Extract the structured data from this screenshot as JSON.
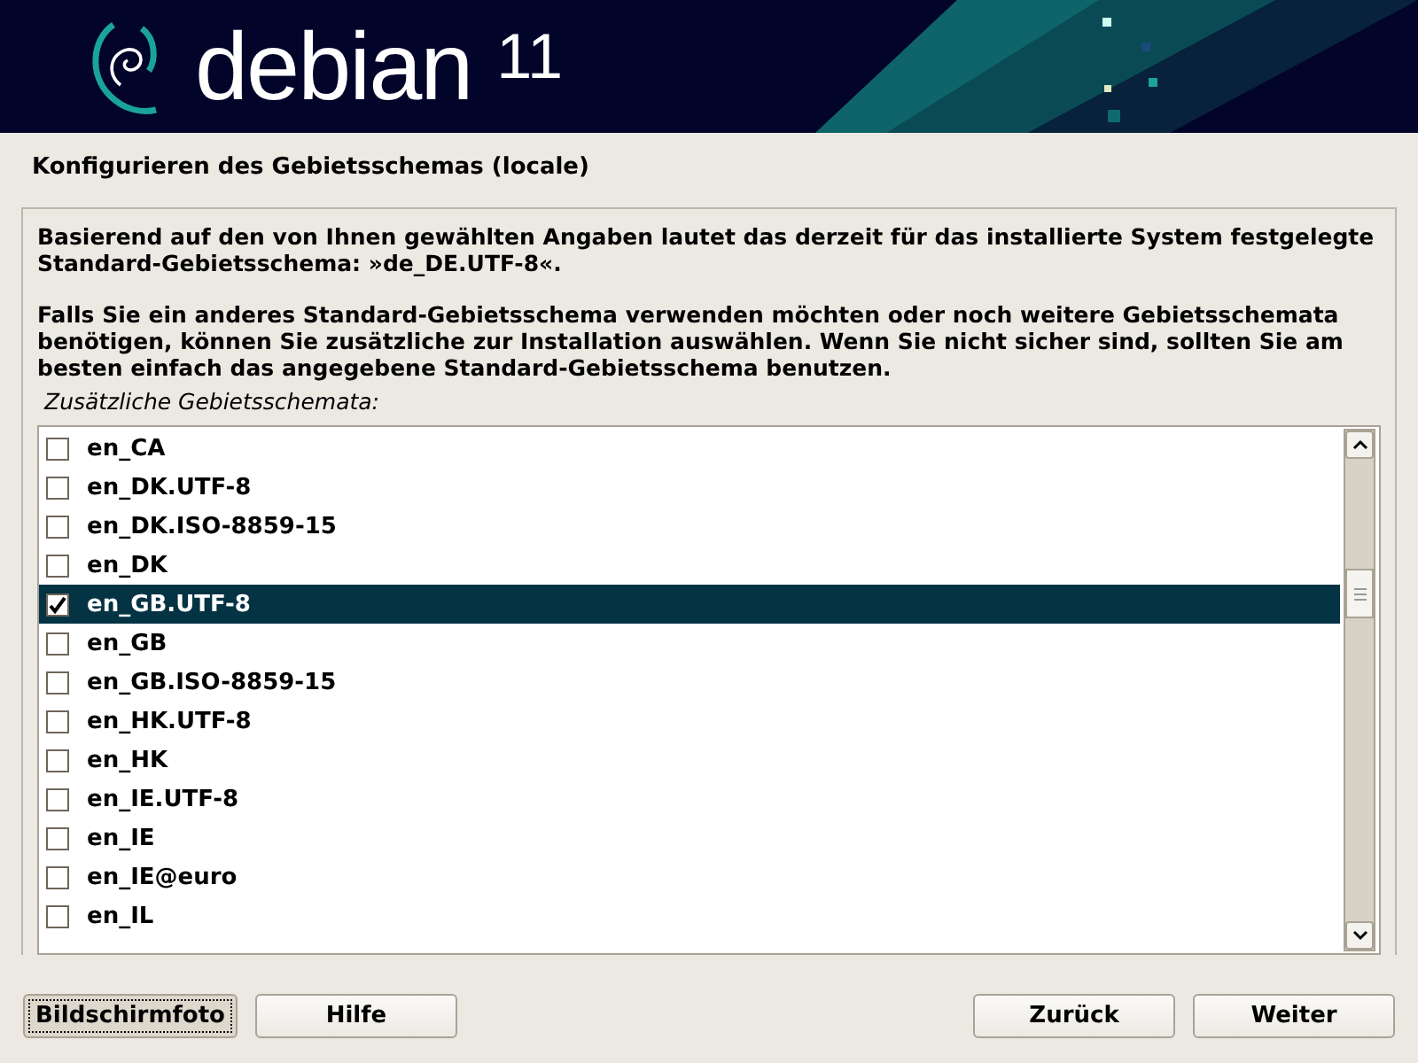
{
  "header": {
    "brand": "debian",
    "version": "11"
  },
  "title": "Konfigurieren des Gebietsschemas (locale)",
  "paragraphs": [
    "Basierend auf den von Ihnen gewählten Angaben lautet das derzeit für das installierte System festgelegte Standard-Gebietsschema: »de_DE.UTF-8«.",
    "Falls Sie ein anderes Standard-Gebietsschema verwenden möchten oder noch weitere Gebietsschemata benötigen, können Sie zusätzliche zur Installation auswählen. Wenn Sie nicht sicher sind, sollten Sie am besten einfach das angegebene Standard-Gebietsschema benutzen."
  ],
  "list_label": "Zusätzliche Gebietsschemata:",
  "locales": [
    {
      "label": "en_CA",
      "checked": false,
      "selected": false
    },
    {
      "label": "en_DK.UTF-8",
      "checked": false,
      "selected": false
    },
    {
      "label": "en_DK.ISO-8859-15",
      "checked": false,
      "selected": false
    },
    {
      "label": "en_DK",
      "checked": false,
      "selected": false
    },
    {
      "label": "en_GB.UTF-8",
      "checked": true,
      "selected": true
    },
    {
      "label": "en_GB",
      "checked": false,
      "selected": false
    },
    {
      "label": "en_GB.ISO-8859-15",
      "checked": false,
      "selected": false
    },
    {
      "label": "en_HK.UTF-8",
      "checked": false,
      "selected": false
    },
    {
      "label": "en_HK",
      "checked": false,
      "selected": false
    },
    {
      "label": "en_IE.UTF-8",
      "checked": false,
      "selected": false
    },
    {
      "label": "en_IE",
      "checked": false,
      "selected": false
    },
    {
      "label": "en_IE@euro",
      "checked": false,
      "selected": false
    },
    {
      "label": "en_IL",
      "checked": false,
      "selected": false
    }
  ],
  "buttons_left": [
    {
      "label": "Bildschirmfoto",
      "focused": true
    },
    {
      "label": "Hilfe",
      "focused": false
    }
  ],
  "buttons_right": [
    {
      "label": "Zurück",
      "focused": false
    },
    {
      "label": "Weiter",
      "focused": false
    }
  ]
}
